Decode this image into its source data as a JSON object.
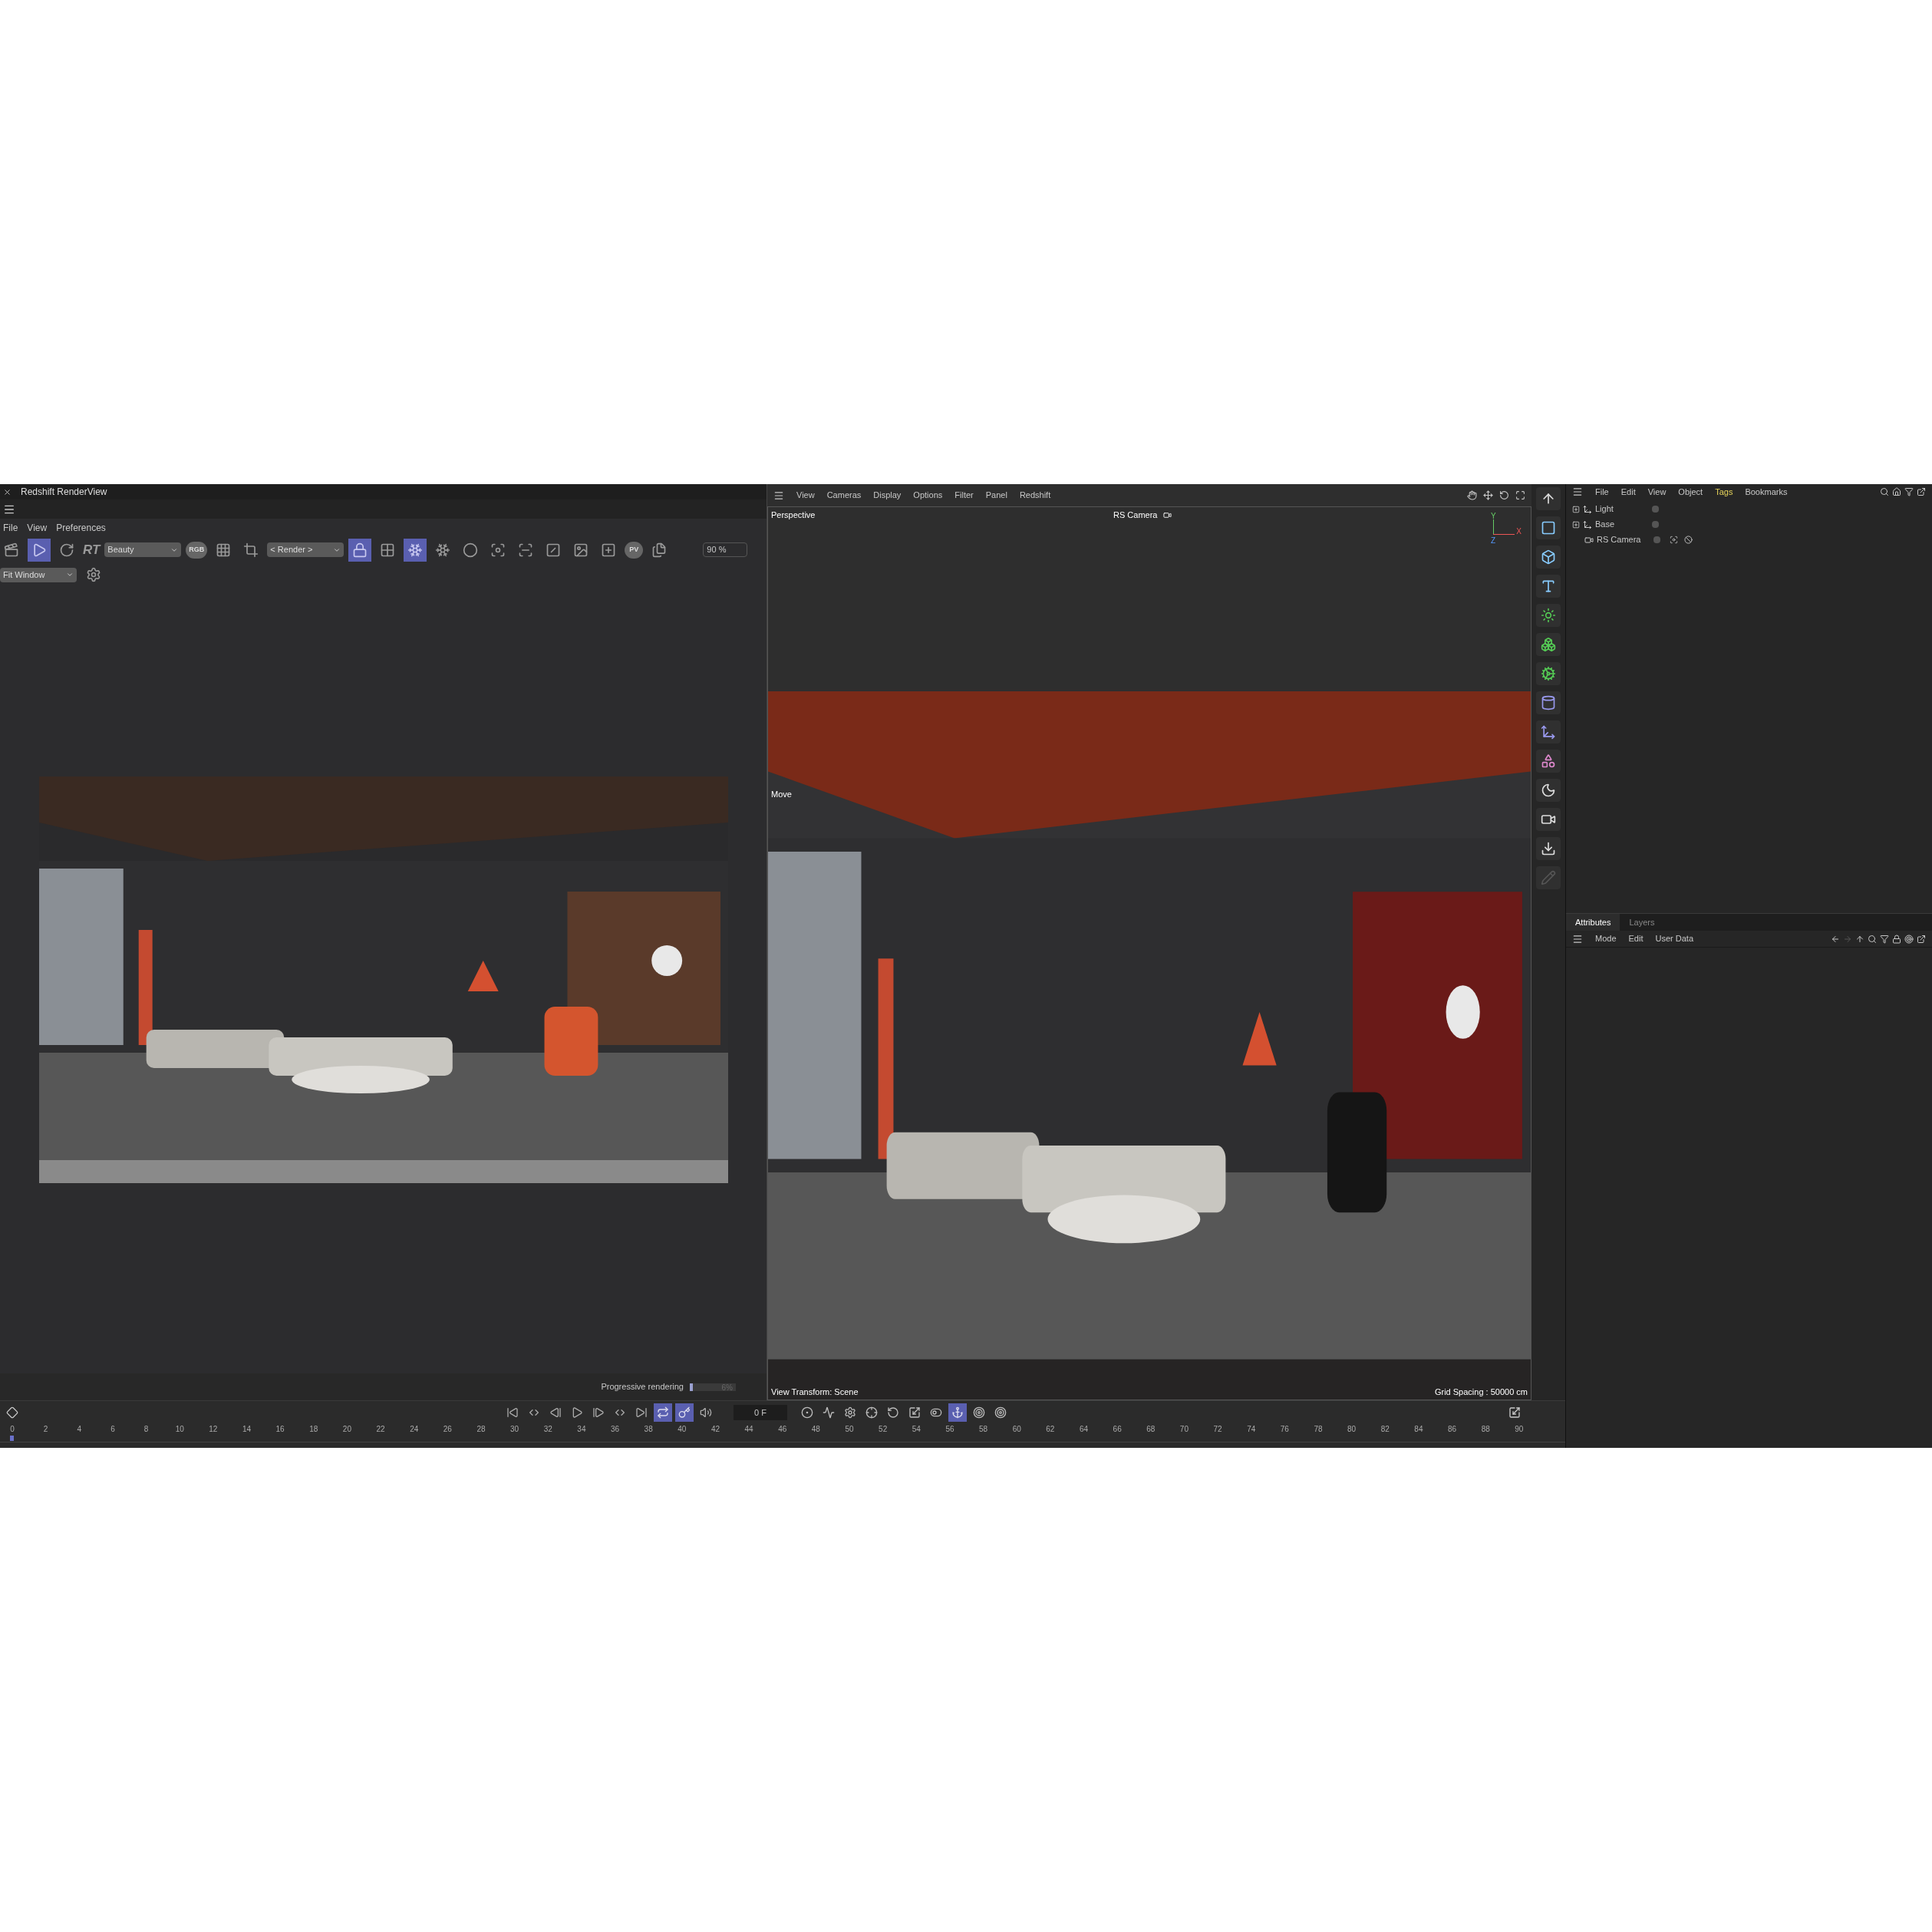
{
  "render_view": {
    "title": "Redshift RenderView",
    "menu": [
      "File",
      "View",
      "Preferences"
    ],
    "toolbar": [
      {
        "kind": "icon",
        "active": false
      },
      {
        "kind": "icon",
        "active": true
      },
      {
        "kind": "icon",
        "active": false
      },
      {
        "kind": "text",
        "label": "RT"
      },
      {
        "kind": "dropdown",
        "value": "Beauty"
      },
      {
        "kind": "badge",
        "label": "RGB"
      },
      {
        "kind": "icon",
        "active": false
      },
      {
        "kind": "icon",
        "active": false
      },
      {
        "kind": "dropdown",
        "value": "< Render >"
      },
      {
        "kind": "icon",
        "active": true
      },
      {
        "kind": "icon",
        "active": false
      },
      {
        "kind": "icon",
        "active": true
      },
      {
        "kind": "icon",
        "active": false
      },
      {
        "kind": "icon",
        "active": false
      },
      {
        "kind": "icon",
        "active": false
      },
      {
        "kind": "icon",
        "active": false
      },
      {
        "kind": "icon",
        "active": false
      },
      {
        "kind": "icon",
        "active": false
      },
      {
        "kind": "icon",
        "active": false
      },
      {
        "kind": "badge",
        "label": "PV"
      },
      {
        "kind": "icon",
        "active": false
      },
      {
        "kind": "field",
        "value": "90 %"
      }
    ],
    "fit_dropdown": "Fit Window",
    "status": {
      "label": "Progressive rendering",
      "level": 0.06,
      "reading": "6%"
    }
  },
  "viewport": {
    "menu": [
      "View",
      "Cameras",
      "Display",
      "Options",
      "Filter",
      "Panel",
      "Redshift"
    ],
    "view_name": "Perspective",
    "camera": "RS Camera",
    "axis_labels": [
      "Y",
      "X",
      "Z"
    ],
    "tool": "Move",
    "view_transform": "View Transform: Scene",
    "grid_spacing": "Grid Spacing : 50000 cm"
  },
  "object_manager": {
    "menu": [
      {
        "label": "File",
        "selected": false
      },
      {
        "label": "Edit",
        "selected": false
      },
      {
        "label": "View",
        "selected": false
      },
      {
        "label": "Object",
        "selected": false
      },
      {
        "label": "Tags",
        "selected": true
      },
      {
        "label": "Bookmarks",
        "selected": false
      }
    ],
    "objects": [
      {
        "name": "Light",
        "kind": "null"
      },
      {
        "name": "Base",
        "kind": "null"
      },
      {
        "name": "RS Camera",
        "kind": "camera"
      }
    ]
  },
  "attributes": {
    "tabs": [
      {
        "label": "Attributes",
        "selected": true
      },
      {
        "label": "Layers",
        "selected": false
      }
    ],
    "menu": [
      "Mode",
      "Edit",
      "User Data"
    ]
  },
  "timeline": {
    "transport": [
      {
        "active": false
      },
      {
        "active": false
      },
      {
        "active": false
      },
      {
        "active": false
      },
      {
        "active": false
      },
      {
        "active": false
      },
      {
        "active": false
      },
      {
        "active": true
      },
      {
        "active": true
      },
      {
        "active": false
      }
    ],
    "current_frame": "0 F",
    "keys": [
      {
        "active": false
      },
      {
        "active": false
      },
      {
        "active": false
      },
      {
        "active": false
      },
      {
        "active": false
      },
      {
        "active": false
      },
      {
        "active": false
      },
      {
        "active": true
      },
      {
        "active": false
      },
      {
        "active": false
      }
    ],
    "ticks": [
      "0",
      "2",
      "4",
      "6",
      "8",
      "10",
      "12",
      "14",
      "16",
      "18",
      "20",
      "22",
      "24",
      "26",
      "28",
      "30",
      "32",
      "34",
      "36",
      "38",
      "40",
      "42",
      "44",
      "46",
      "48",
      "50",
      "52",
      "54",
      "56",
      "58",
      "60",
      "62",
      "64",
      "66",
      "68",
      "70",
      "72",
      "74",
      "76",
      "78",
      "80",
      "82",
      "84",
      "86",
      "88",
      "90"
    ]
  }
}
